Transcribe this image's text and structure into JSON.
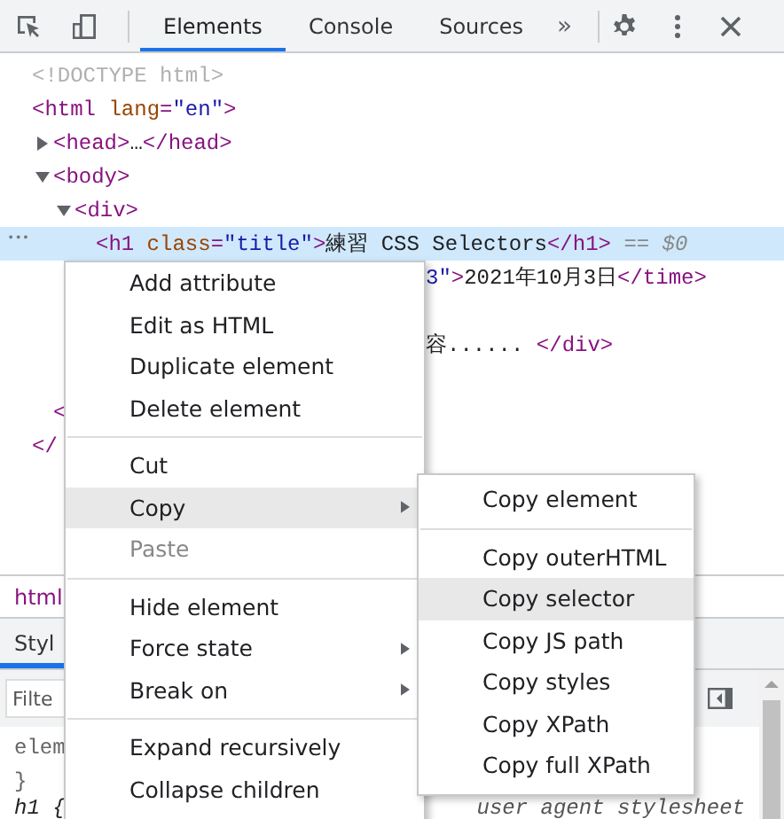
{
  "toolbar": {
    "tabs": [
      {
        "label": "Elements",
        "selected": true
      },
      {
        "label": "Console",
        "selected": false
      },
      {
        "label": "Sources",
        "selected": false
      }
    ],
    "more": "»"
  },
  "dom": {
    "nodes": [
      {
        "kind": "element",
        "segments": [
          {
            "kind": "doctype",
            "text": "<!DOCTYPE html>"
          }
        ]
      },
      {
        "kind": "element",
        "segments": [
          {
            "kind": "tag",
            "text": "<html"
          },
          {
            "kind": "attr",
            "text": " lang"
          },
          {
            "kind": "punct",
            "text": "="
          },
          {
            "kind": "value",
            "text": "\"en\""
          },
          {
            "kind": "tag",
            "text": ">"
          }
        ],
        "children": [
          {
            "kind": "element",
            "expanded": false,
            "segments": [
              {
                "kind": "tag",
                "text": "<head>"
              },
              {
                "kind": "text",
                "text": "…"
              },
              {
                "kind": "tag",
                "text": "</head>"
              }
            ]
          },
          {
            "kind": "element",
            "expanded": true,
            "segments": [
              {
                "kind": "tag",
                "text": "<body>"
              }
            ],
            "children": [
              {
                "kind": "element",
                "expanded": true,
                "segments": [
                  {
                    "kind": "tag",
                    "text": "<div>"
                  }
                ],
                "children": [
                  {
                    "kind": "element",
                    "selected": true,
                    "gutter": "•••",
                    "segments": [
                      {
                        "kind": "tag",
                        "text": "<h1"
                      },
                      {
                        "kind": "attr",
                        "text": " class"
                      },
                      {
                        "kind": "punct",
                        "text": "="
                      },
                      {
                        "kind": "value",
                        "text": "\"title\""
                      },
                      {
                        "kind": "tag",
                        "text": ">"
                      },
                      {
                        "kind": "text",
                        "text": "練習 CSS Selectors"
                      },
                      {
                        "kind": "tag",
                        "text": "</h1>"
                      },
                      {
                        "kind": "hint",
                        "text": " == $0"
                      }
                    ]
                  },
                  {
                    "kind": "fragment",
                    "segments": [
                      {
                        "kind": "value",
                        "text": "3\""
                      },
                      {
                        "kind": "tag",
                        "text": ">"
                      },
                      {
                        "kind": "text",
                        "text": "2021年10月3日"
                      },
                      {
                        "kind": "tag",
                        "text": "</time>"
                      }
                    ]
                  },
                  {
                    "kind": "blank"
                  },
                  {
                    "kind": "fragment",
                    "segments": [
                      {
                        "kind": "text",
                        "text": "容...... "
                      },
                      {
                        "kind": "tag",
                        "text": "</div>"
                      }
                    ]
                  },
                  {
                    "kind": "blank"
                  }
                ]
              }
            ],
            "closing": [
              {
                "kind": "tag",
                "text": "<"
              }
            ]
          }
        ],
        "closing": [
          {
            "kind": "tag",
            "text": "</"
          }
        ]
      }
    ]
  },
  "breadcrumb": "html",
  "styles": {
    "tab": "Styl",
    "filter_placeholder": "Filte",
    "rules": [
      {
        "kind": "code",
        "text": "elem"
      },
      {
        "kind": "code",
        "text": "}"
      },
      {
        "kind": "italic",
        "text": "h1 {",
        "source": "user agent stylesheet"
      }
    ]
  },
  "context_menu": {
    "groups": [
      [
        {
          "label": "Add attribute",
          "selected": false,
          "disabled": false,
          "submenu": false
        },
        {
          "label": "Edit as HTML",
          "selected": false,
          "disabled": false,
          "submenu": false
        },
        {
          "label": "Duplicate element",
          "selected": false,
          "disabled": false,
          "submenu": false
        },
        {
          "label": "Delete element",
          "selected": false,
          "disabled": false,
          "submenu": false
        }
      ],
      [
        {
          "label": "Cut",
          "selected": false,
          "disabled": false,
          "submenu": false
        },
        {
          "label": "Copy",
          "selected": true,
          "disabled": false,
          "submenu": true
        },
        {
          "label": "Paste",
          "selected": false,
          "disabled": true,
          "submenu": false
        }
      ],
      [
        {
          "label": "Hide element",
          "selected": false,
          "disabled": false,
          "submenu": false
        },
        {
          "label": "Force state",
          "selected": false,
          "disabled": false,
          "submenu": true
        },
        {
          "label": "Break on",
          "selected": false,
          "disabled": false,
          "submenu": true
        }
      ],
      [
        {
          "label": "Expand recursively",
          "selected": false,
          "disabled": false,
          "submenu": false
        },
        {
          "label": "Collapse children",
          "selected": false,
          "disabled": false,
          "submenu": false
        }
      ]
    ]
  },
  "submenu": {
    "groups": [
      [
        {
          "label": "Copy element",
          "selected": false
        }
      ],
      [
        {
          "label": "Copy outerHTML",
          "selected": false
        },
        {
          "label": "Copy selector",
          "selected": true
        },
        {
          "label": "Copy JS path",
          "selected": false
        },
        {
          "label": "Copy styles",
          "selected": false
        },
        {
          "label": "Copy XPath",
          "selected": false
        },
        {
          "label": "Copy full XPath",
          "selected": false
        }
      ]
    ]
  }
}
